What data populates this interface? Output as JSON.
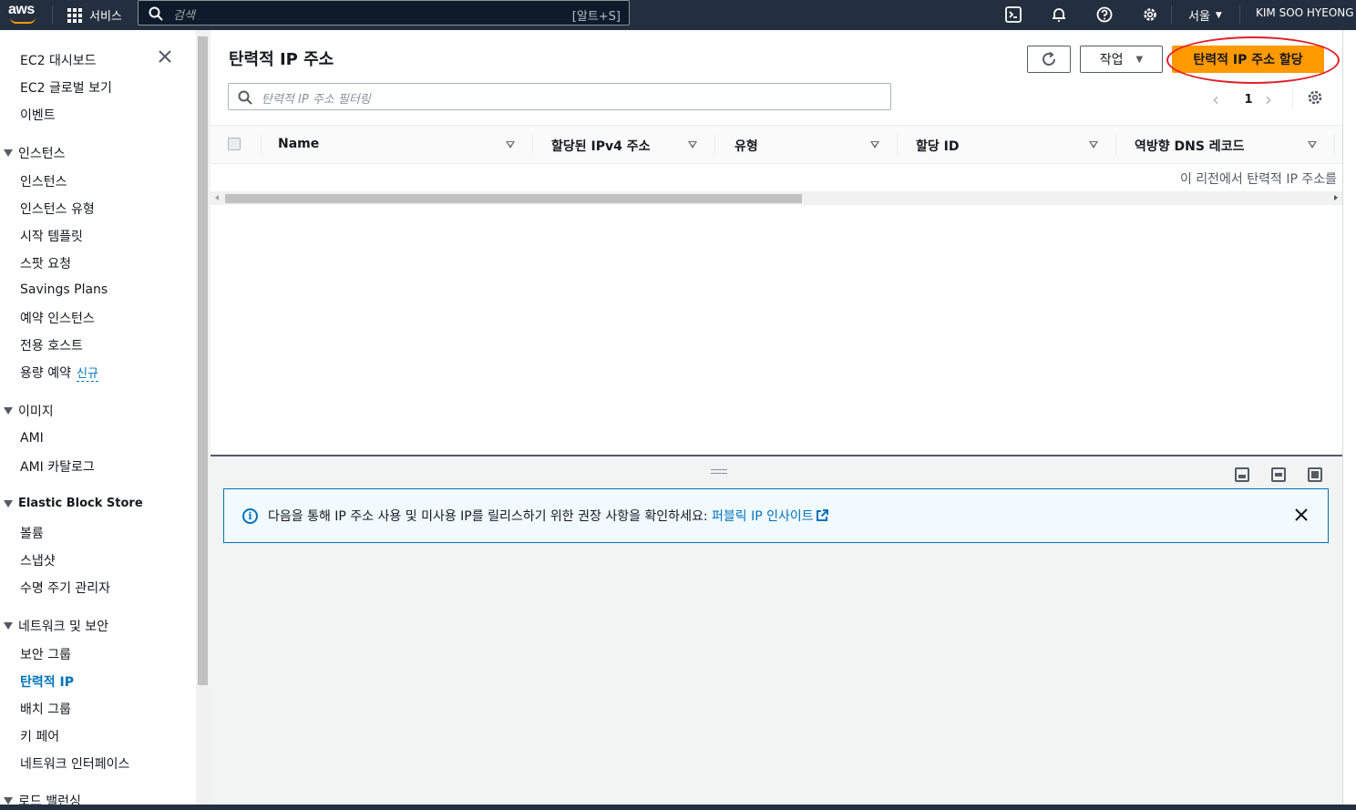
{
  "topnav": {
    "logo": "aws",
    "services_label": "서비스",
    "search_placeholder": "검색",
    "search_shortcut": "[알트+S]",
    "icons": [
      "cloudshell-icon",
      "bell-icon",
      "help-icon",
      "gear-icon"
    ],
    "region": "서울",
    "user": "KIM SOO HYEONG"
  },
  "sidebar": {
    "top_items": [
      "EC2 대시보드",
      "EC2 글로벌 보기",
      "이벤트"
    ],
    "sections": [
      {
        "title": "인스턴스",
        "items": [
          "인스턴스",
          "인스턴스 유형",
          "시작 템플릿",
          "스팟 요청",
          "Savings Plans",
          "예약 인스턴스",
          "전용 호스트",
          "용량 예약"
        ]
      },
      {
        "title": "이미지",
        "items": [
          "AMI",
          "AMI 카탈로그"
        ]
      },
      {
        "title": "Elastic Block Store",
        "items": [
          "볼륨",
          "스냅샷",
          "수명 주기 관리자"
        ]
      },
      {
        "title": "네트워크 및 보안",
        "items": [
          "보안 그룹",
          "탄력적 IP",
          "배치 그룹",
          "키 페어",
          "네트워크 인터페이스"
        ]
      },
      {
        "title": "로드 밸런싱",
        "items": []
      }
    ],
    "new_badge": "신규",
    "active_item": "탄력적 IP"
  },
  "main": {
    "title": "탄력적 IP 주소",
    "actions_label": "작업",
    "allocate_label": "탄력적 IP 주소 할당",
    "filter_placeholder": "탄력적 IP 주소 필터링",
    "page_number": "1",
    "columns": [
      "Name",
      "할당된 IPv4 주소",
      "유형",
      "할당 ID",
      "역방향 DNS 레코드"
    ],
    "empty_message": "이 리전에서 탄력적 IP 주소를"
  },
  "alert": {
    "text": "다음을 통해 IP 주소 사용 및 미사용 IP를 릴리스하기 위한 권장 사항을 확인하세요: ",
    "link": "퍼블릭 IP 인사이트"
  },
  "colors": {
    "nav_bg": "#232f3e",
    "accent": "#ec7211",
    "link": "#0073bb",
    "annotation": "#e0202b"
  }
}
